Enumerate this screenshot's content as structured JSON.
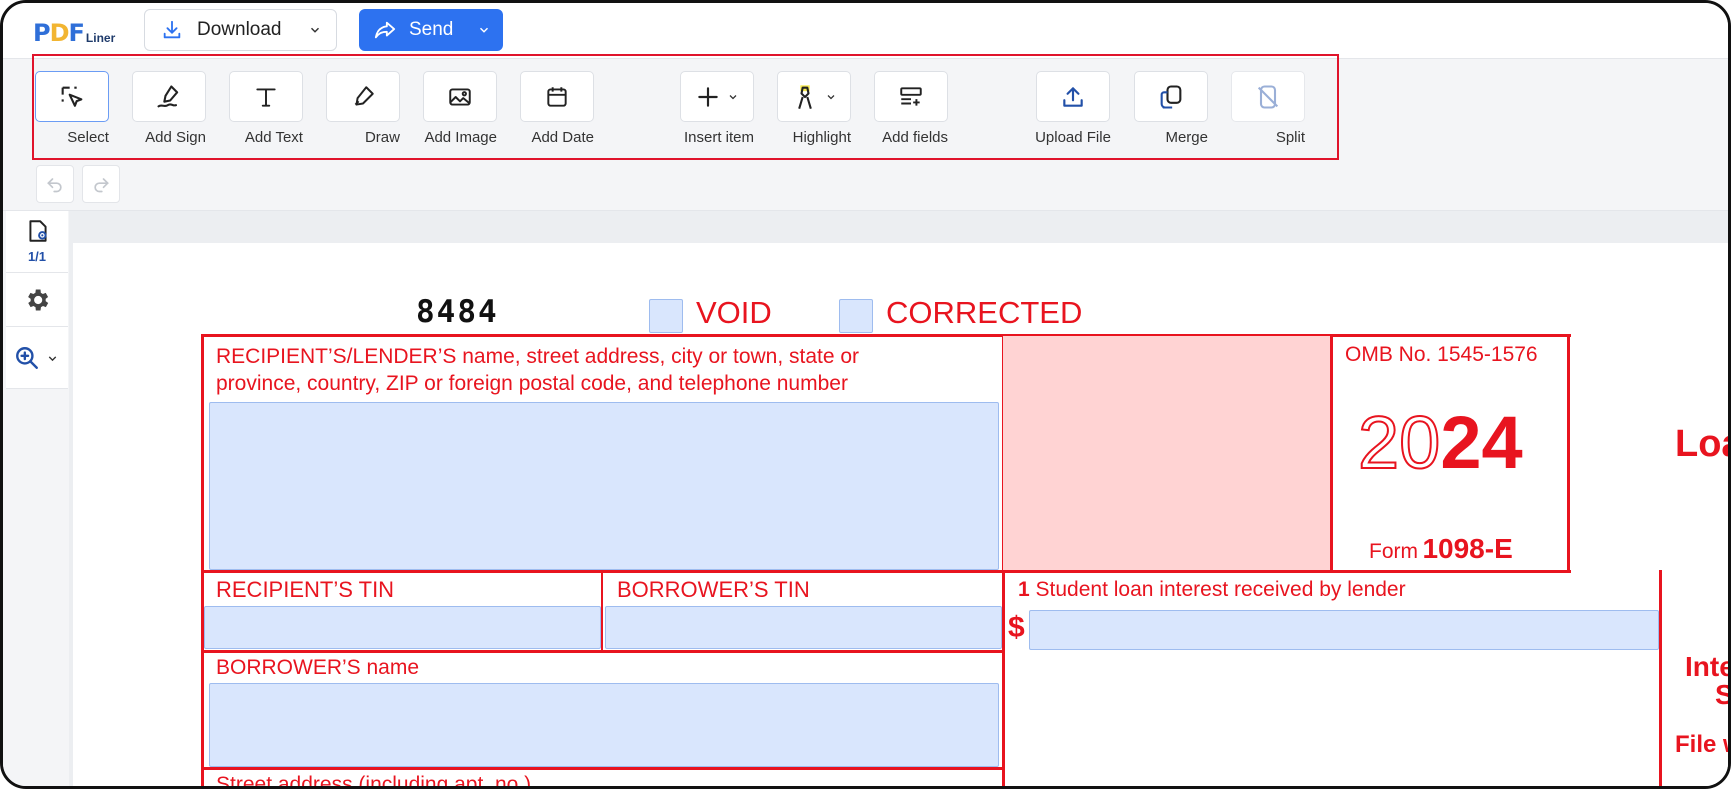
{
  "app": {
    "logo_pdf_p": "P",
    "logo_pdf_d": "D",
    "logo_pdf_f": "F",
    "logo_liner": "Liner",
    "download_label": "Download",
    "send_label": "Send",
    "accent": "#2d72f0"
  },
  "toolbar": {
    "tools": [
      {
        "label": "Select",
        "icon": "select-cursor-icon"
      },
      {
        "label": "Add Sign",
        "icon": "sign-pen-icon"
      },
      {
        "label": "Add Text",
        "icon": "text-t-icon"
      },
      {
        "label": "Draw",
        "icon": "draw-pen-icon"
      },
      {
        "label": "Add Image",
        "icon": "image-icon"
      },
      {
        "label": "Add Date",
        "icon": "calendar-icon"
      },
      {
        "label": "Insert item",
        "icon": "plus-icon"
      },
      {
        "label": "Highlight",
        "icon": "highlighter-icon"
      },
      {
        "label": "Add fields",
        "icon": "fields-icon"
      },
      {
        "label": "Upload File",
        "icon": "upload-icon"
      },
      {
        "label": "Merge",
        "icon": "merge-icon"
      },
      {
        "label": "Split",
        "icon": "split-icon"
      }
    ],
    "highlight_color": "#e0142b"
  },
  "sidebar": {
    "page_count": "1/1"
  },
  "form": {
    "code": "8484",
    "void_label": "VOID",
    "corrected_label": "CORRECTED",
    "recipient_label_line1": "RECIPIENT’S/LENDER’S name, street address, city or town, state or",
    "recipient_label_line2": "province, country, ZIP or foreign postal code, and telephone number",
    "omb": "OMB No. 1545-1576",
    "year_outline": "20",
    "year_bold": "24",
    "form_word": "Form",
    "form_number": "1098-E",
    "side_title_partial": "Loa",
    "recipient_tin": "RECIPIENT’S TIN",
    "borrower_tin": "BORROWER’S TIN",
    "box1_num": "1",
    "box1_label": "Student loan interest received by lender",
    "dollar": "$",
    "borrower_name": "BORROWER’S name",
    "street_address": "Street address (including apt. no.)",
    "side_inte": "Inte",
    "side_s": "S",
    "side_file": "File w",
    "form_color": "#e8141f",
    "field_color": "#d9e6fd"
  }
}
